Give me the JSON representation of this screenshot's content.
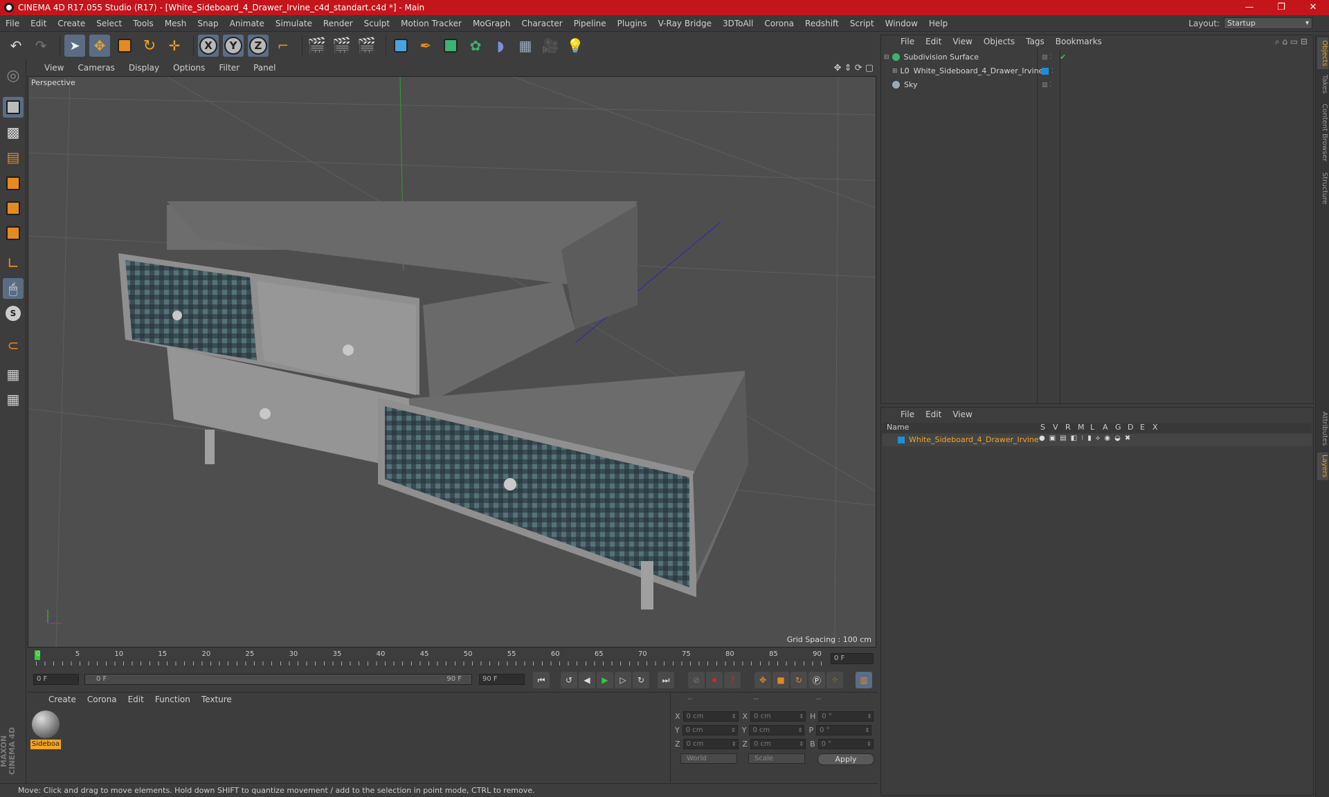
{
  "window": {
    "title": "CINEMA 4D R17.055 Studio (R17) - [White_Sideboard_4_Drawer_Irvine_c4d_standart.c4d *] - Main",
    "minimize": "—",
    "maximize": "❐",
    "close": "✕"
  },
  "menubar": {
    "items": [
      "File",
      "Edit",
      "Create",
      "Select",
      "Tools",
      "Mesh",
      "Snap",
      "Animate",
      "Simulate",
      "Render",
      "Sculpt",
      "Motion Tracker",
      "MoGraph",
      "Character",
      "Pipeline",
      "Plugins",
      "V-Ray Bridge",
      "3DToAll",
      "Corona",
      "Redshift",
      "Script",
      "Window",
      "Help"
    ],
    "layout_label": "Layout:",
    "layout_value": "Startup"
  },
  "toolbar": {
    "axis_x": "X",
    "axis_y": "Y",
    "axis_z": "Z"
  },
  "viewport": {
    "menu": [
      "View",
      "Cameras",
      "Display",
      "Options",
      "Filter",
      "Panel"
    ],
    "label": "Perspective",
    "grid_spacing": "Grid Spacing : 100 cm"
  },
  "timeline": {
    "ticks": [
      "0",
      "5",
      "10",
      "15",
      "20",
      "25",
      "30",
      "35",
      "40",
      "45",
      "50",
      "55",
      "60",
      "65",
      "70",
      "75",
      "80",
      "85",
      "90"
    ],
    "current_frame": "0 F",
    "start_field": "0 F",
    "range_start": "0 F",
    "range_end": "90 F",
    "end_field": "90 F"
  },
  "material_panel": {
    "menu": [
      "Create",
      "Corona",
      "Edit",
      "Function",
      "Texture"
    ],
    "material_name": "Sideboa"
  },
  "coord_panel": {
    "header_1": "--",
    "header_2": "--",
    "header_3": "--",
    "rows": [
      {
        "a": "X",
        "av": "0 cm",
        "b": "X",
        "bv": "0 cm",
        "c": "H",
        "cv": "0 °"
      },
      {
        "a": "Y",
        "av": "0 cm",
        "b": "Y",
        "bv": "0 cm",
        "c": "P",
        "cv": "0 °"
      },
      {
        "a": "Z",
        "av": "0 cm",
        "b": "Z",
        "bv": "0 cm",
        "c": "B",
        "cv": "0 °"
      }
    ],
    "dropdown_1": "World",
    "dropdown_2": "Scale",
    "apply": "Apply"
  },
  "object_manager": {
    "menu": [
      "File",
      "Edit",
      "View",
      "Objects",
      "Tags",
      "Bookmarks"
    ],
    "objects": [
      "Subdivision Surface",
      "White_Sideboard_4_Drawer_Irvine",
      "Sky"
    ]
  },
  "layer_manager": {
    "menu": [
      "File",
      "Edit",
      "View"
    ],
    "columns": [
      "Name",
      "S",
      "V",
      "R",
      "M",
      "L",
      "A",
      "G",
      "D",
      "E",
      "X"
    ],
    "layer_name": "White_Sideboard_4_Drawer_Irvine"
  },
  "right_tabs": [
    "Objects",
    "Takes",
    "Content Browser",
    "Structure",
    "Attributes",
    "Layers"
  ],
  "status": "Move: Click and drag to move elements. Hold down SHIFT to quantize movement / add to the selection in point mode, CTRL to remove.",
  "logo": "MAXON CINEMA 4D",
  "colors": {
    "accent": "#c4151c",
    "selection": "#5a6d85",
    "layer_text": "#f5a623"
  }
}
